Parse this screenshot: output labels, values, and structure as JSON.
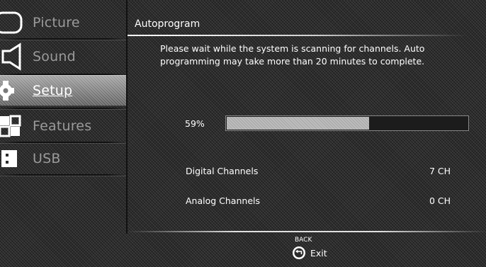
{
  "sidebar": {
    "items": [
      {
        "label": "Picture",
        "icon": "picture-icon",
        "active": false
      },
      {
        "label": "Sound",
        "icon": "sound-icon",
        "active": false
      },
      {
        "label": "Setup",
        "icon": "setup-icon",
        "active": true
      },
      {
        "label": "Features",
        "icon": "features-icon",
        "active": false
      },
      {
        "label": "USB",
        "icon": "usb-icon",
        "active": false
      }
    ]
  },
  "panel": {
    "title": "Autoprogram",
    "message": "Please wait while the system is scanning for channels. Auto programming may take more than 20 minutes to complete.",
    "progress": {
      "label": "59%",
      "value": 0.59
    },
    "rows": [
      {
        "label": "Digital Channels",
        "value": "7 CH"
      },
      {
        "label": "Analog Channels",
        "value": "0 CH"
      }
    ]
  },
  "footer": {
    "back_label": "BACK",
    "back_icon": "back-arrow-icon",
    "exit_label": "Exit"
  },
  "colors": {
    "text": "#ffffff",
    "inactive_text": "#9a9a9a",
    "progress_fill": "#bdbdbd",
    "background": "#2b2b2b"
  }
}
